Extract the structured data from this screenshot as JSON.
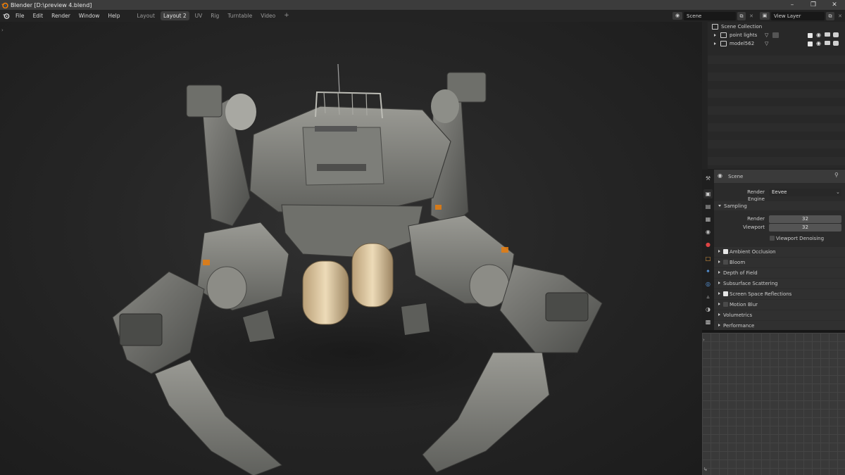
{
  "window": {
    "title": "Blender [D:\\preview 4.blend]"
  },
  "menu": [
    "File",
    "Edit",
    "Render",
    "Window",
    "Help"
  ],
  "workspace_tabs": [
    {
      "label": "Layout",
      "active": false
    },
    {
      "label": "Layout 2",
      "active": true
    },
    {
      "label": "UV",
      "active": false
    },
    {
      "label": "Rig",
      "active": false
    },
    {
      "label": "Turntable",
      "active": false
    },
    {
      "label": "Video",
      "active": false
    }
  ],
  "add_tab_symbol": "+",
  "scene_selector": {
    "value": "Scene"
  },
  "view_layer_selector": {
    "value": "View Layer"
  },
  "outliner": {
    "root": "Scene Collection",
    "rows": [
      {
        "label": "point lights"
      },
      {
        "label": "model562"
      }
    ]
  },
  "properties": {
    "context": "Scene",
    "render_engine_label": "Render Engine",
    "render_engine_value": "Eevee",
    "sampling": {
      "header": "Sampling",
      "render_label": "Render",
      "render_value": "32",
      "viewport_label": "Viewport",
      "viewport_value": "32",
      "denoise_label": "Viewport Denoising",
      "denoise_checked": false
    },
    "sections": [
      {
        "label": "Ambient Occlusion",
        "checkbox": true,
        "checked": true
      },
      {
        "label": "Bloom",
        "checkbox": true,
        "checked": false
      },
      {
        "label": "Depth of Field",
        "checkbox": false
      },
      {
        "label": "Subsurface Scattering",
        "checkbox": false
      },
      {
        "label": "Screen Space Reflections",
        "checkbox": true,
        "checked": true
      },
      {
        "label": "Motion Blur",
        "checkbox": true,
        "checked": false
      },
      {
        "label": "Volumetrics",
        "checkbox": false
      },
      {
        "label": "Performance",
        "checkbox": false
      }
    ]
  },
  "colors": {
    "accent_orange": "#e87d0d",
    "titlebar": "#3c3c3c",
    "panel_bg": "#2b2b2b",
    "viewport_bg": "#262626"
  },
  "icons": [
    "blender-logo-icon",
    "minimize-icon",
    "maximize-icon",
    "close-icon",
    "scene-icon",
    "view-layer-icon",
    "collection-icon",
    "eye-icon",
    "camera-icon",
    "monitor-icon",
    "checkbox-icon",
    "pin-icon"
  ]
}
